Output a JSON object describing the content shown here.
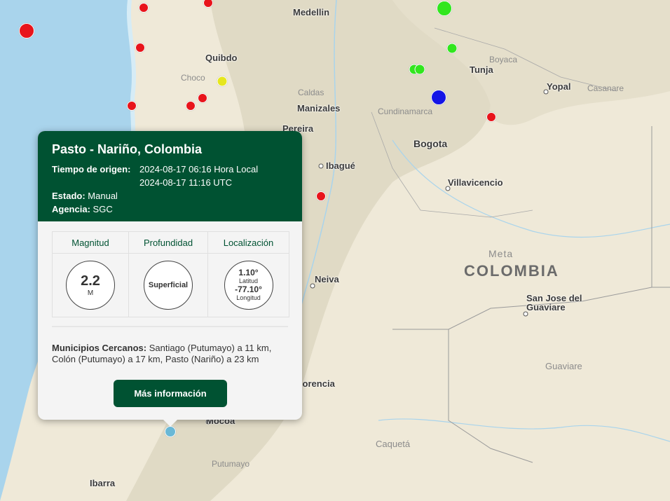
{
  "map": {
    "country_label": "COLOMBIA",
    "cities": [
      "Medellin",
      "Quibdo",
      "Tunja",
      "Yopal",
      "Manizales",
      "Pereira",
      "Bogota",
      "Ibagué",
      "Villavicencio",
      "Neiva",
      "San Jose del",
      "Guaviare",
      "Mocoa",
      "Ibarra",
      "Florencia"
    ],
    "regions": [
      "Choco",
      "Boyaca",
      "Casanare",
      "Caldas",
      "Cundinamarca",
      "Meta",
      "Guaviare",
      "Caquetá",
      "Putumayo"
    ],
    "event_colors": {
      "red": "#e8141b",
      "green": "#32e61e",
      "yellow": "#e6e61e",
      "blue": "#1414e6",
      "selected": "#6ab8d6"
    }
  },
  "popup": {
    "title": "Pasto - Nariño, Colombia",
    "origin_label": "Tiempo de origen:",
    "origin_local": "2024-08-17 06:16 Hora Local",
    "origin_utc": "2024-08-17 11:16 UTC",
    "status_label": "Estado:",
    "status_value": "Manual",
    "agency_label": "Agencia:",
    "agency_value": "SGC",
    "headers": {
      "magnitude": "Magnitud",
      "depth": "Profundidad",
      "location": "Localización"
    },
    "magnitude": {
      "value": "2.2",
      "unit": "M"
    },
    "depth": "Superficial",
    "location": {
      "lat": "1.10°",
      "lat_label": "Latitud",
      "lon": "-77.10°",
      "lon_label": "Longitud"
    },
    "nearby_label": "Municipios Cercanos:",
    "nearby_text": "Santiago (Putumayo) a 11 km, Colón (Putumayo) a 17 km, Pasto (Nariño) a 23 km",
    "more_button": "Más información"
  }
}
